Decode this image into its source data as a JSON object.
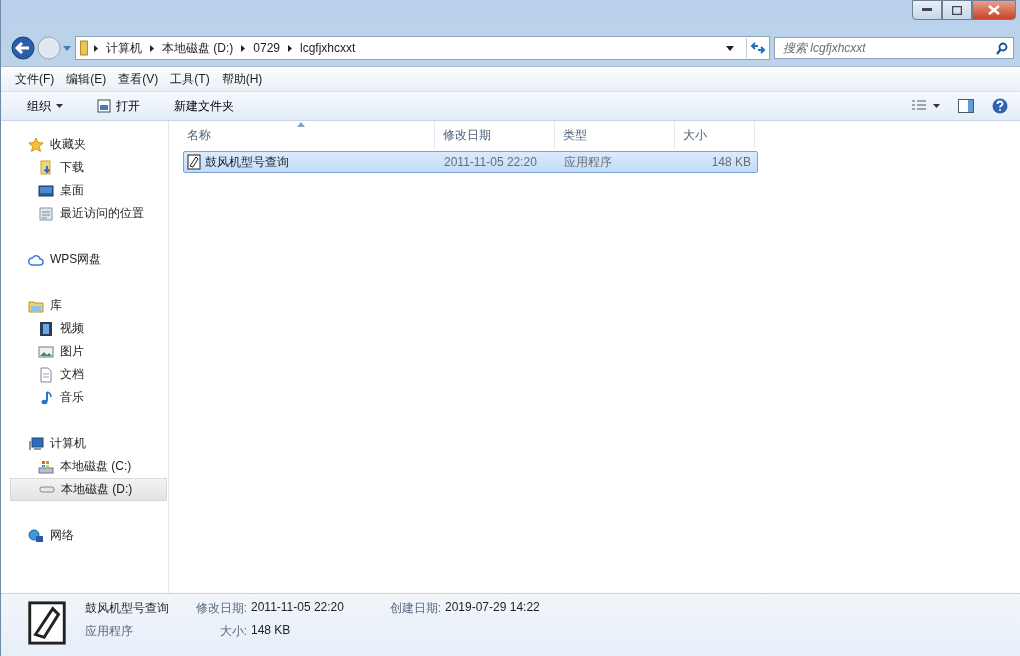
{
  "address_bar": {
    "breadcrumbs": [
      "计算机",
      "本地磁盘 (D:)",
      "0729",
      "lcgfjxhcxxt"
    ]
  },
  "search": {
    "placeholder": "搜索 lcgfjxhcxxt"
  },
  "menu": [
    "文件(F)",
    "编辑(E)",
    "查看(V)",
    "工具(T)",
    "帮助(H)"
  ],
  "toolbar": [
    {
      "label": "组织",
      "kind": "dropdown"
    },
    {
      "label": "打开",
      "kind": "open"
    },
    {
      "label": "新建文件夹",
      "kind": "plain"
    }
  ],
  "sidebar": [
    {
      "label": "收藏夹",
      "kind": "star",
      "selected": false,
      "children": [
        {
          "label": "下载",
          "kind": "download",
          "selected": false
        },
        {
          "label": "桌面",
          "kind": "desktop",
          "selected": false
        },
        {
          "label": "最近访问的位置",
          "kind": "recent",
          "selected": false
        }
      ]
    },
    {
      "label": "WPS网盘",
      "kind": "cloud",
      "selected": false
    },
    {
      "label": "库",
      "kind": "library",
      "selected": false,
      "children": [
        {
          "label": "视频",
          "kind": "video",
          "selected": false
        },
        {
          "label": "图片",
          "kind": "picture",
          "selected": false
        },
        {
          "label": "文档",
          "kind": "document",
          "selected": false
        },
        {
          "label": "音乐",
          "kind": "music",
          "selected": false
        }
      ]
    },
    {
      "label": "计算机",
      "kind": "computer",
      "selected": false,
      "children": [
        {
          "label": "本地磁盘 (C:)",
          "kind": "system-drive",
          "selected": false
        },
        {
          "label": "本地磁盘 (D:)",
          "kind": "drive",
          "selected": true
        }
      ]
    },
    {
      "label": "网络",
      "kind": "network",
      "selected": false
    }
  ],
  "table": {
    "columns": [
      {
        "label": "名称",
        "sorted": true
      },
      {
        "label": "修改日期",
        "sorted": false
      },
      {
        "label": "类型",
        "sorted": false
      },
      {
        "label": "大小",
        "sorted": false
      }
    ],
    "rows": [
      {
        "name": "鼓风机型号查询",
        "modified": "2011-11-05 22:20",
        "type": "应用程序",
        "size": "148 KB",
        "selected": true
      }
    ]
  },
  "details": {
    "name": "鼓风机型号查询",
    "type": "应用程序",
    "fields": [
      {
        "label": "修改日期:",
        "value": "2011-11-05 22:20"
      },
      {
        "label": "大小:",
        "value": "148 KB"
      },
      {
        "label": "创建日期:",
        "value": "2019-07-29 14:22"
      }
    ]
  }
}
